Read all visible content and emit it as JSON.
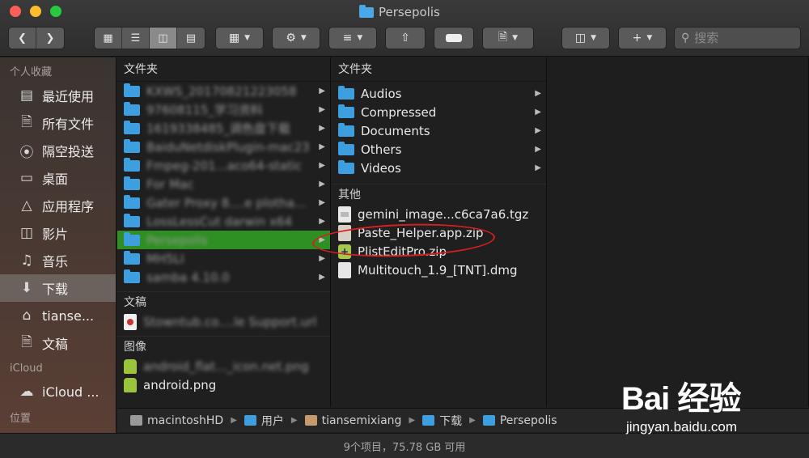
{
  "window": {
    "title": "Persepolis",
    "folder_color": "#4aa7e8"
  },
  "toolbar": {
    "back_icon": "chevron-left-icon",
    "forward_icon": "chevron-right-icon",
    "view_modes": [
      "icon-view-icon",
      "list-view-icon",
      "column-view-icon",
      "gallery-view-icon"
    ],
    "active_view": "column-view-icon",
    "search_placeholder": "搜索"
  },
  "sidebar": {
    "favorites_header": "个人收藏",
    "items": [
      {
        "label": "最近使用",
        "icon": "recents-icon"
      },
      {
        "label": "所有文件",
        "icon": "all-files-icon"
      },
      {
        "label": "隔空投送",
        "icon": "airdrop-icon"
      },
      {
        "label": "桌面",
        "icon": "desktop-icon"
      },
      {
        "label": "应用程序",
        "icon": "applications-icon"
      },
      {
        "label": "影片",
        "icon": "movies-icon"
      },
      {
        "label": "音乐",
        "icon": "music-icon"
      },
      {
        "label": "下载",
        "icon": "downloads-icon"
      },
      {
        "label": "tianse...",
        "icon": "home-icon"
      },
      {
        "label": "文稿",
        "icon": "documents-icon"
      }
    ],
    "active_item": "下载",
    "icloud_header": "iCloud",
    "icloud_item": "iCloud ...",
    "locations_header": "位置"
  },
  "column1": {
    "header": "文件夹",
    "folders": [
      {
        "name": "KXWS_20170821223058"
      },
      {
        "name": "97608115_学习资料"
      },
      {
        "name": "1619338485_调色盘下载"
      },
      {
        "name": "BaiduNetdiskPlugin-mac23"
      },
      {
        "name": "Fmpeg-201...aco64-static"
      },
      {
        "name": "For Mac"
      },
      {
        "name": "Gater Proxy 8....e plothacker"
      },
      {
        "name": "LossLessCut darwin x64"
      },
      {
        "name": "Persepolis",
        "selected": true
      },
      {
        "name": "MH5LI"
      },
      {
        "name": "samba 4.10.0"
      }
    ],
    "docs_header": "文稿",
    "docs": [
      {
        "name": "Stowntub.co....le Support.url"
      }
    ],
    "images_header": "图像",
    "images": [
      {
        "name": "android_flat..._icon.net.png"
      },
      {
        "name": "android.png"
      }
    ]
  },
  "column2": {
    "header": "文件夹",
    "folders": [
      {
        "name": "Audios"
      },
      {
        "name": "Compressed"
      },
      {
        "name": "Documents"
      },
      {
        "name": "Others"
      },
      {
        "name": "Videos"
      }
    ],
    "other_header": "其他",
    "files": [
      {
        "name": "gemini_image...c6ca7a6.tgz",
        "icon": "tgz-file-icon"
      },
      {
        "name": "Paste_Helper.app.zip",
        "icon": "zip-file-icon"
      },
      {
        "name": "PlistEditPro.zip",
        "icon": "plist-zip-icon"
      },
      {
        "name": "Multitouch_1.9_[TNT].dmg",
        "icon": "dmg-file-icon"
      }
    ]
  },
  "pathbar": {
    "segments": [
      "macintoshHD",
      "用户",
      "tiansemixiang",
      "下载",
      "Persepolis"
    ]
  },
  "statusbar": {
    "text": "9个项目，75.78 GB 可用"
  },
  "annotation": {
    "color": "#d5201f",
    "target": "Paste_Helper.app.zip"
  },
  "watermark": {
    "logo": "Bai 经验",
    "url": "jingyan.baidu.com"
  }
}
